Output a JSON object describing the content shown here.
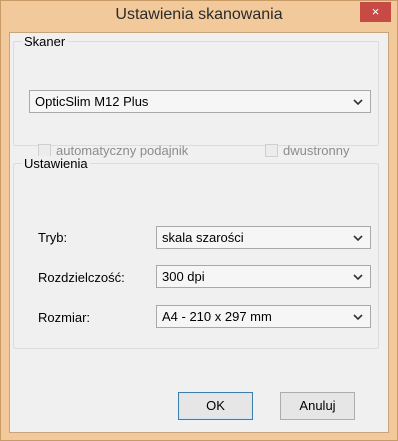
{
  "window": {
    "title": "Ustawienia skanowania",
    "close_glyph": "×"
  },
  "scanner_group": {
    "label": "Skaner",
    "selected_scanner": "OpticSlim M12 Plus",
    "auto_feeder_label": "automatyczny podajnik",
    "duplex_label": "dwustronny"
  },
  "settings_group": {
    "label": "Ustawienia",
    "mode_label": "Tryb:",
    "mode_value": "skala szarości",
    "resolution_label": "Rozdzielczość:",
    "resolution_value": "300 dpi",
    "size_label": "Rozmiar:",
    "size_value": "A4 - 210 x 297 mm"
  },
  "buttons": {
    "ok": "OK",
    "cancel": "Anuluj"
  },
  "colors": {
    "titlebar": "#f2c99a",
    "close": "#c74a45"
  }
}
